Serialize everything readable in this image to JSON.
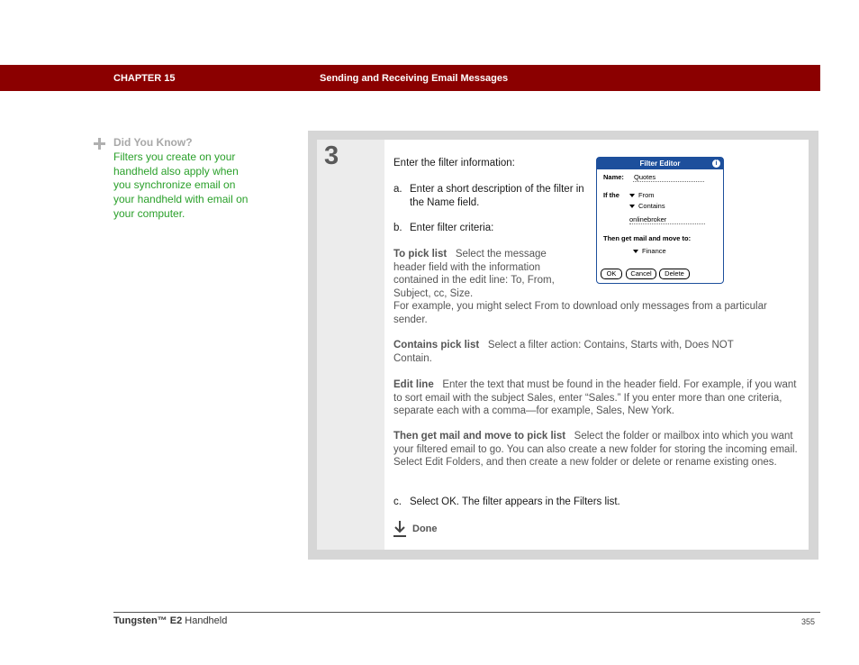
{
  "header": {
    "chapter": "CHAPTER 15",
    "title": "Sending and Receiving Email Messages",
    "bar_color": "#8b0000"
  },
  "did_you_know": {
    "title": "Did You Know?",
    "body": "Filters you create on your handheld also apply when you synchronize email on your handheld with email on your computer.",
    "body_color": "#2aa02a"
  },
  "step": {
    "number": "3",
    "intro": "Enter the filter information:",
    "a_label": "a.",
    "a_text": "Enter a short description of the filter in the Name field.",
    "b_label": "b.",
    "b_text": "Enter filter criteria:",
    "to_term": "To pick list",
    "to_desc": "Select the message header field with the information contained in the edit line: To, From, Subject, cc, Size.",
    "to_example": "For example, you might select From to download only messages from a particular sender.",
    "contains_term": "Contains pick list",
    "contains_desc": "Select a filter action: Contains, Starts with, Does NOT Contain.",
    "edit_term": "Edit line",
    "edit_desc": "Enter the text that must be found in the header field. For example, if you want to sort email with the subject Sales, enter “Sales.” If you enter more than one criteria, separate each with a comma—for example, Sales, New York.",
    "then_term": "Then get mail and move to pick list",
    "then_desc": "Select the folder or mailbox into which you want your filtered email to go. You can also create a new folder for storing the incoming email. Select Edit Folders, and then create a new folder or delete or rename existing ones.",
    "c_label": "c.",
    "c_text": "Select OK. The filter appears in the Filters list.",
    "done_label": "Done"
  },
  "device": {
    "title": "Filter Editor",
    "info_icon": "i",
    "name_label": "Name:",
    "name_value": "Quotes",
    "if_label": "If the",
    "field_select": "From",
    "action_select": "Contains",
    "edit_value": "onlinebroker",
    "then_label": "Then get mail and move to:",
    "folder_select": "Finance",
    "buttons": [
      "OK",
      "Cancel",
      "Delete"
    ]
  },
  "footer": {
    "product_bold": "Tungsten™ E2",
    "product_rest": " Handheld",
    "page": "355"
  }
}
